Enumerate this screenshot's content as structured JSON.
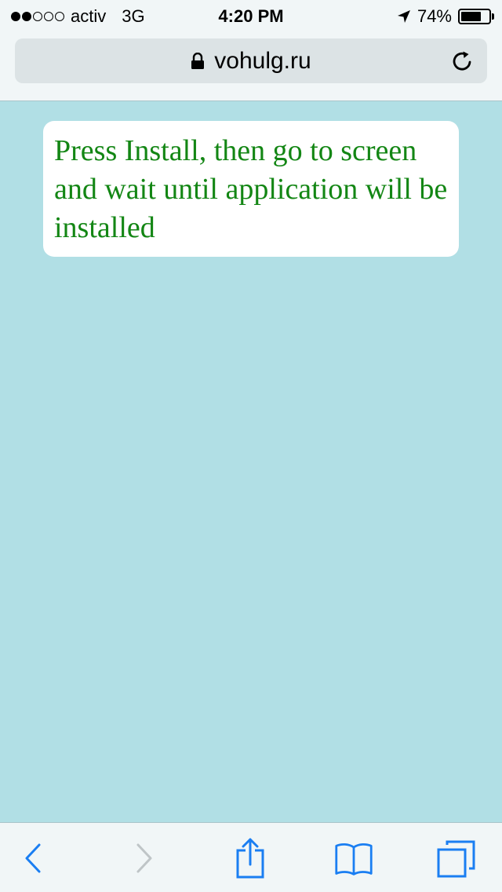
{
  "status_bar": {
    "signal_bars_filled": 2,
    "signal_bars_total": 5,
    "carrier": "activ",
    "network": "3G",
    "time": "4:20 PM",
    "battery_percent_label": "74%",
    "battery_level": 0.74
  },
  "address_bar": {
    "url": "vohulg.ru",
    "secure_icon": "lock-icon",
    "reload_icon": "reload-icon"
  },
  "page": {
    "message": "Press Install, then go to screen and wait until application will be installed",
    "message_color": "#138614",
    "background_color": "#b1dfe5"
  },
  "toolbar": {
    "back_icon": "back-icon",
    "forward_icon": "forward-icon",
    "share_icon": "share-icon",
    "bookmarks_icon": "bookmarks-icon",
    "tabs_icon": "tabs-icon",
    "accent_color": "#1a7ef2"
  }
}
